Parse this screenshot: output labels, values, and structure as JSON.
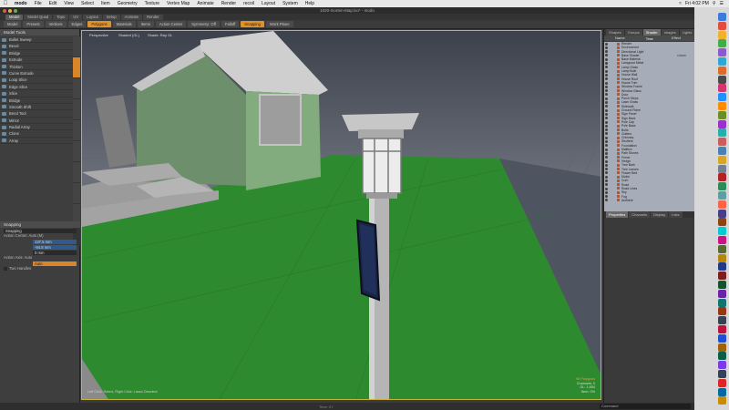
{
  "menubar": {
    "app": "modo",
    "items": [
      "File",
      "Edit",
      "View",
      "Select",
      "Item",
      "Geometry",
      "Texture",
      "Vertex Map",
      "Animate",
      "Render",
      "recoil",
      "Layout",
      "System",
      "Help"
    ],
    "clock": "Fri 4:02 PM"
  },
  "window": {
    "title": "1020-morten-Map.lxo* - modo"
  },
  "layout_tabs": [
    "Model",
    "Model Quad",
    "Topo",
    "UV",
    "Layout",
    "Setup",
    "Animate",
    "Render"
  ],
  "toolbar": {
    "buttons": [
      "Model",
      "Presets",
      "Vertices",
      "Edges",
      "Polygons",
      "Materials",
      "Items",
      "Action Center",
      "Symmetry: Off",
      "Falloff",
      "Snapping",
      "Work Plane"
    ],
    "active": "Polygons"
  },
  "tools": {
    "header": "Model Tools",
    "items": [
      "Bullet Sweep",
      "Bevel",
      "Bridge",
      "Extrude",
      "Thicken",
      "Curve Extrude",
      "Loop Slice",
      "Edge Slice",
      "Slice",
      "Bridge",
      "Smooth Shift",
      "Bend Tool",
      "Mirror",
      "Radial Array",
      "Clone",
      "Array"
    ]
  },
  "properties": {
    "title": "Snapping",
    "preset_label": "Snapping",
    "action_center_label": "Action Center: Auto (M)",
    "values": [
      "137.5 mm",
      "-94.8 mm",
      "0 mm"
    ],
    "axis_label": "Action Axis: Auto",
    "axis_value": "Auto",
    "two_handles": "Two Handles"
  },
  "viewport": {
    "labels": [
      "Perspective",
      "Shaded (GL)",
      "Shade: Ray GL"
    ],
    "info": [
      "96 Polygons",
      "Channels: 0",
      "GL: 1,654",
      "Item: 0%"
    ],
    "tip": "Left Click: Select, Right Click: Lasso Deselect"
  },
  "shapes": {
    "tabs": [
      "Shapes",
      "Groups",
      "Shader Tree",
      "Images",
      "Lights",
      "Items Tab"
    ],
    "active_tab": "Shader Tree",
    "columns": [
      "Name",
      "Effect"
    ],
    "items": [
      {
        "name": "Render",
        "type": "",
        "sel": false
      },
      {
        "name": "Environment",
        "type": "",
        "sel": false
      },
      {
        "name": "Directional Light",
        "type": "",
        "sel": false
      },
      {
        "name": "Base Shader",
        "type": "shader",
        "sel": false
      },
      {
        "name": "Base Material",
        "type": "",
        "sel": false
      },
      {
        "name": "Lamppost Metal",
        "type": "",
        "sel": false
      },
      {
        "name": "Lamp Glass",
        "type": "",
        "sel": false
      },
      {
        "name": "Lamp Bulb",
        "type": "",
        "sel": false
      },
      {
        "name": "House Wall",
        "type": "",
        "sel": false
      },
      {
        "name": "House Roof",
        "type": "",
        "sel": false
      },
      {
        "name": "House Trim",
        "type": "",
        "sel": false
      },
      {
        "name": "Window Frame",
        "type": "",
        "sel": false
      },
      {
        "name": "Window Glass",
        "type": "",
        "sel": false
      },
      {
        "name": "Door",
        "type": "",
        "sel": false
      },
      {
        "name": "Porch Steps",
        "type": "",
        "sel": false
      },
      {
        "name": "Lawn Grass",
        "type": "",
        "sel": false
      },
      {
        "name": "Sidewalk",
        "type": "",
        "sel": false
      },
      {
        "name": "Ground Plane",
        "type": "",
        "sel": false
      },
      {
        "name": "Sign Panel",
        "type": "",
        "sel": false
      },
      {
        "name": "Sign Back",
        "type": "",
        "sel": false
      },
      {
        "name": "Pole Cap",
        "type": "",
        "sel": false
      },
      {
        "name": "Pole Base",
        "type": "",
        "sel": false
      },
      {
        "name": "Bolts",
        "type": "",
        "sel": false
      },
      {
        "name": "Gutters",
        "type": "",
        "sel": false
      },
      {
        "name": "Chimney",
        "type": "",
        "sel": false
      },
      {
        "name": "Shutters",
        "type": "",
        "sel": false
      },
      {
        "name": "Foundation",
        "type": "",
        "sel": false
      },
      {
        "name": "Mailbox",
        "type": "",
        "sel": false
      },
      {
        "name": "Path Stones",
        "type": "",
        "sel": false
      },
      {
        "name": "Fence",
        "type": "",
        "sel": false
      },
      {
        "name": "Hedge",
        "type": "",
        "sel": false
      },
      {
        "name": "Tree Bark",
        "type": "",
        "sel": false
      },
      {
        "name": "Tree Leaves",
        "type": "",
        "sel": false
      },
      {
        "name": "Flower Bed",
        "type": "",
        "sel": false
      },
      {
        "name": "Mulch",
        "type": "",
        "sel": false
      },
      {
        "name": "Curb",
        "type": "",
        "sel": false
      },
      {
        "name": "Road",
        "type": "",
        "sel": false
      },
      {
        "name": "Road Lines",
        "type": "",
        "sel": false
      },
      {
        "name": "Sky",
        "type": "",
        "sel": false
      },
      {
        "name": "Fog",
        "type": "",
        "sel": false
      },
      {
        "name": "Ambient",
        "type": "",
        "sel": false
      }
    ]
  },
  "lower_tabs": [
    "Properties",
    "Channels",
    "Display",
    "Lists"
  ],
  "status": {
    "timeline": "Time: 0 f",
    "command_placeholder": "Command"
  }
}
